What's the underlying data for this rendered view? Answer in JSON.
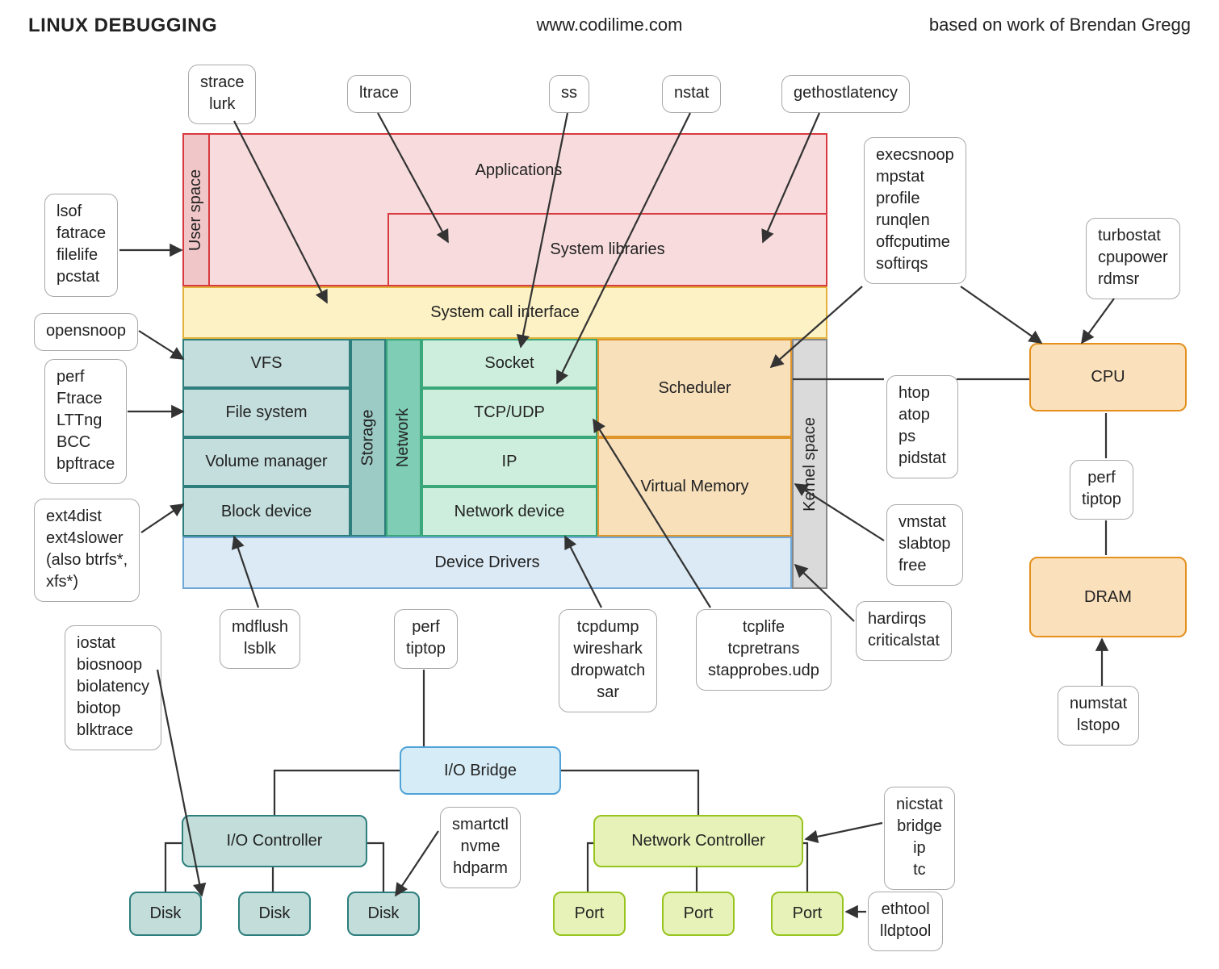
{
  "header": {
    "title": "LINUX DEBUGGING",
    "url": "www.codilime.com",
    "credit": "based on work of Brendan Gregg"
  },
  "regions": {
    "user_space": "User space",
    "kernel_space": "Kernel space"
  },
  "layers": {
    "applications": "Applications",
    "system_libraries": "System libraries",
    "system_call_interface": "System call interface",
    "device_drivers": "Device Drivers"
  },
  "storage": {
    "column_label": "Storage",
    "vfs": "VFS",
    "file_system": "File system",
    "volume_manager": "Volume manager",
    "block_device": "Block device"
  },
  "network": {
    "column_label": "Network",
    "socket": "Socket",
    "tcp_udp": "TCP/UDP",
    "ip": "IP",
    "network_device": "Network device"
  },
  "kernel": {
    "scheduler": "Scheduler",
    "virtual_memory": "Virtual Memory"
  },
  "hw": {
    "cpu": "CPU",
    "dram": "DRAM",
    "io_bridge": "I/O Bridge",
    "io_controller": "I/O Controller",
    "network_controller": "Network Controller",
    "disk": "Disk",
    "port": "Port"
  },
  "tools": {
    "strace": [
      "strace",
      "lurk"
    ],
    "ltrace": [
      "ltrace"
    ],
    "ss": [
      "ss"
    ],
    "nstat": [
      "nstat"
    ],
    "gethost": [
      "gethostlatency"
    ],
    "lsof": [
      "lsof",
      "fatrace",
      "filelife",
      "pcstat"
    ],
    "opensnoop": [
      "opensnoop"
    ],
    "perf_ftrace": [
      "perf",
      "Ftrace",
      "LTTng",
      "BCC",
      "bpftrace"
    ],
    "ext4": [
      "ext4dist",
      "ext4slower",
      "(also btrfs*,",
      "xfs*)"
    ],
    "execsnoop": [
      "execsnoop",
      "mpstat",
      "profile",
      "runqlen",
      "offcputime",
      "softirqs"
    ],
    "turbostat": [
      "turbostat",
      "cpupower",
      "rdmsr"
    ],
    "htop": [
      "htop",
      "atop",
      "ps",
      "pidstat"
    ],
    "perf_tiptop_r": [
      "perf",
      "tiptop"
    ],
    "vmstat": [
      "vmstat",
      "slabtop",
      "free"
    ],
    "hardirqs": [
      "hardirqs",
      "criticalstat"
    ],
    "numstat": [
      "numstat",
      "lstopo"
    ],
    "mdflush": [
      "mdflush",
      "lsblk"
    ],
    "perf_tiptop": [
      "perf",
      "tiptop"
    ],
    "tcpdump": [
      "tcpdump",
      "wireshark",
      "dropwatch",
      "sar"
    ],
    "tcplife": [
      "tcplife",
      "tcpretrans",
      "stapprobes.udp"
    ],
    "iostat": [
      "iostat",
      "biosnoop",
      "biolatency",
      "biotop",
      "blktrace"
    ],
    "smartctl": [
      "smartctl",
      "nvme",
      "hdparm"
    ],
    "nicstat": [
      "nicstat",
      "bridge",
      "ip",
      "tc"
    ],
    "ethtool": [
      "ethtool",
      "lldptool"
    ]
  },
  "colors": {
    "userspace_bg": "#f0c6c8",
    "userspace_br": "#d83a3f",
    "syscall_bg": "#fdf2c5",
    "syscall_br": "#e2b23a",
    "storage_bg": "#c4dedd",
    "storage_br": "#2d7e7d",
    "storage_col_bg": "#9ccac4",
    "network_bg": "#cdeedd",
    "network_br": "#3aa77a",
    "network_col_bg": "#7fcdb4",
    "kernel_bg": "#f8e0bb",
    "kernel_br": "#e0942c",
    "kernel_col_bg": "#dadada",
    "kernel_col_br": "#888888",
    "drivers_bg": "#dbeaf5",
    "drivers_br": "#6fa8d6",
    "cpu_bg": "#fbe1bb",
    "cpu_br": "#e58f1e",
    "io_bg": "#d6ecf6",
    "io_br": "#4fa3d8",
    "ioctrl_bg": "#c2ddda",
    "ioctrl_br": "#2d7e7d",
    "netctrl_bg": "#e6f2b8",
    "netctrl_br": "#98c41f"
  }
}
